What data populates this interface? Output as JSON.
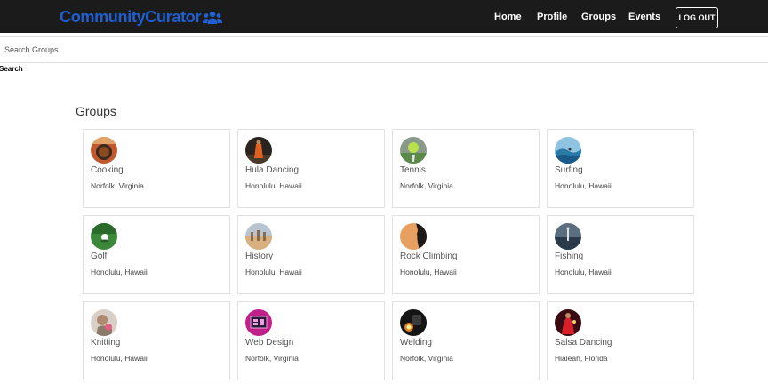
{
  "navbar": {
    "brand": "CommunityCurator",
    "brand_icon": "people-group-icon",
    "links": [
      "Home",
      "Profile",
      "Groups",
      "Events"
    ],
    "logout_label": "LOG OUT"
  },
  "search": {
    "placeholder": "Search Groups",
    "button_label": "Search"
  },
  "main": {
    "title": "Groups",
    "groups": [
      {
        "name": "Cooking",
        "location": "Norfolk, Virginia"
      },
      {
        "name": "Hula Dancing",
        "location": "Honolulu, Hawaii"
      },
      {
        "name": "Tennis",
        "location": "Norfolk, Virginia"
      },
      {
        "name": "Surfing",
        "location": "Honolulu, Hawaii"
      },
      {
        "name": "Golf",
        "location": "Honolulu, Hawaii"
      },
      {
        "name": "History",
        "location": "Honolulu, Hawaii"
      },
      {
        "name": "Rock Climbing",
        "location": "Honolulu, Hawaii"
      },
      {
        "name": "Fishing",
        "location": "Honolulu, Hawaii"
      },
      {
        "name": "Knitting",
        "location": "Honolulu, Hawaii"
      },
      {
        "name": "Web Design",
        "location": "Norfolk, Virginia"
      },
      {
        "name": "Welding",
        "location": "Norfolk, Virginia"
      },
      {
        "name": "Salsa Dancing",
        "location": "Hialeah, Florida"
      }
    ]
  },
  "colors": {
    "navbar_bg": "#1b1b1b",
    "brand": "#1f5fd1"
  }
}
